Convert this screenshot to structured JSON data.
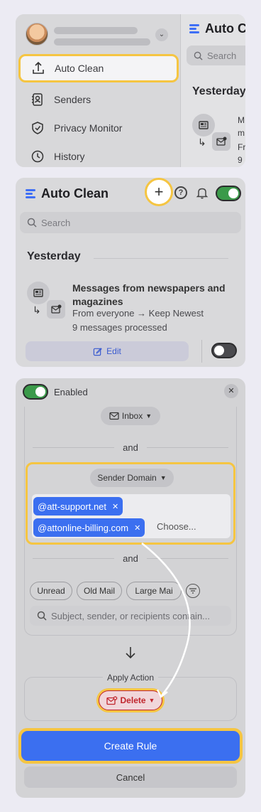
{
  "sidebar": {
    "items": [
      {
        "label": "Auto Clean",
        "icon": "auto-clean-icon"
      },
      {
        "label": "Senders",
        "icon": "senders-icon"
      },
      {
        "label": "Privacy Monitor",
        "icon": "shield-icon"
      },
      {
        "label": "History",
        "icon": "history-icon"
      }
    ]
  },
  "right_pane": {
    "title": "Auto C",
    "search_placeholder": "Search",
    "section": "Yesterday",
    "trunc_lines": [
      "M",
      "m",
      "Fr",
      "9"
    ]
  },
  "auto_clean": {
    "title": "Auto Clean",
    "plus": "+",
    "help": "?",
    "search_placeholder": "Search",
    "section": "Yesterday",
    "rule": {
      "title": "Messages from newspapers and magazines",
      "detail": "From everyone → Keep Newest",
      "processed": "9 messages processed"
    },
    "edit_label": "Edit"
  },
  "rule_editor": {
    "enabled_label": "Enabled",
    "close": "✕",
    "mailbox": "Inbox",
    "and_1": "and",
    "domain_dropdown": "Sender Domain",
    "domains": [
      "@att-support.net",
      "@attonline-billing.com"
    ],
    "choose_placeholder": "Choose...",
    "and_2": "and",
    "filters": [
      "Unread",
      "Old Mail",
      "Large Mai"
    ],
    "subject_placeholder": "Subject, sender, or recipients contain...",
    "apply_action_label": "Apply Action",
    "action": "Delete",
    "create_label": "Create Rule",
    "cancel_label": "Cancel"
  },
  "colors": {
    "accent": "#3b6ff0",
    "highlight": "#f5c542",
    "toggle_on": "#3b9a4a",
    "delete": "#c0262d"
  }
}
